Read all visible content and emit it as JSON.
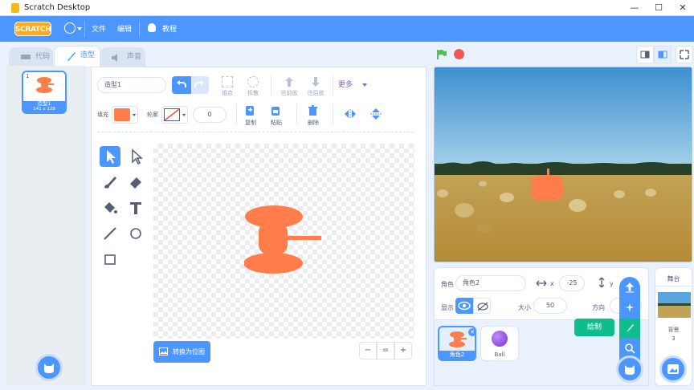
{
  "window": {
    "title": "Scratch Desktop",
    "min": "—",
    "max": "☐",
    "close": "✕"
  },
  "menubar": {
    "logo": "SCRATCH",
    "file": "文件",
    "edit": "编辑",
    "tutorials": "教程"
  },
  "tabs": {
    "code": "代码",
    "costumes": "造型",
    "sounds": "声音"
  },
  "costume_list": {
    "index": "1",
    "name": "造型1",
    "size": "141 x 128"
  },
  "paint_editor": {
    "costume_name": "造型1",
    "more_label": "更多",
    "group": "组合",
    "ungroup": "拆散",
    "forward": "往前放",
    "backward": "往后放",
    "fill_label": "填充",
    "outline_label": "轮廓",
    "outline_width": "0",
    "copy": "复制",
    "paste": "粘贴",
    "delete": "删除",
    "fill_color": "#ff7d4a",
    "convert_bitmap": "转换为位图",
    "zoom_out": "−",
    "zoom_reset": "=",
    "zoom_in": "+"
  },
  "sprite_info": {
    "sprite_label": "角色",
    "sprite_name": "角色2",
    "x_label": "x",
    "x_value": "-25",
    "y_label": "y",
    "show_label": "显示",
    "size_label": "大小",
    "size_value": "50",
    "direction_label": "方向"
  },
  "sprites": [
    {
      "name": "角色2",
      "selected": true
    },
    {
      "name": "Ball",
      "selected": false
    }
  ],
  "stage_panel": {
    "title": "舞台",
    "backdrop_label": "背景",
    "backdrop_count": "3"
  },
  "tooltip": "绘制"
}
